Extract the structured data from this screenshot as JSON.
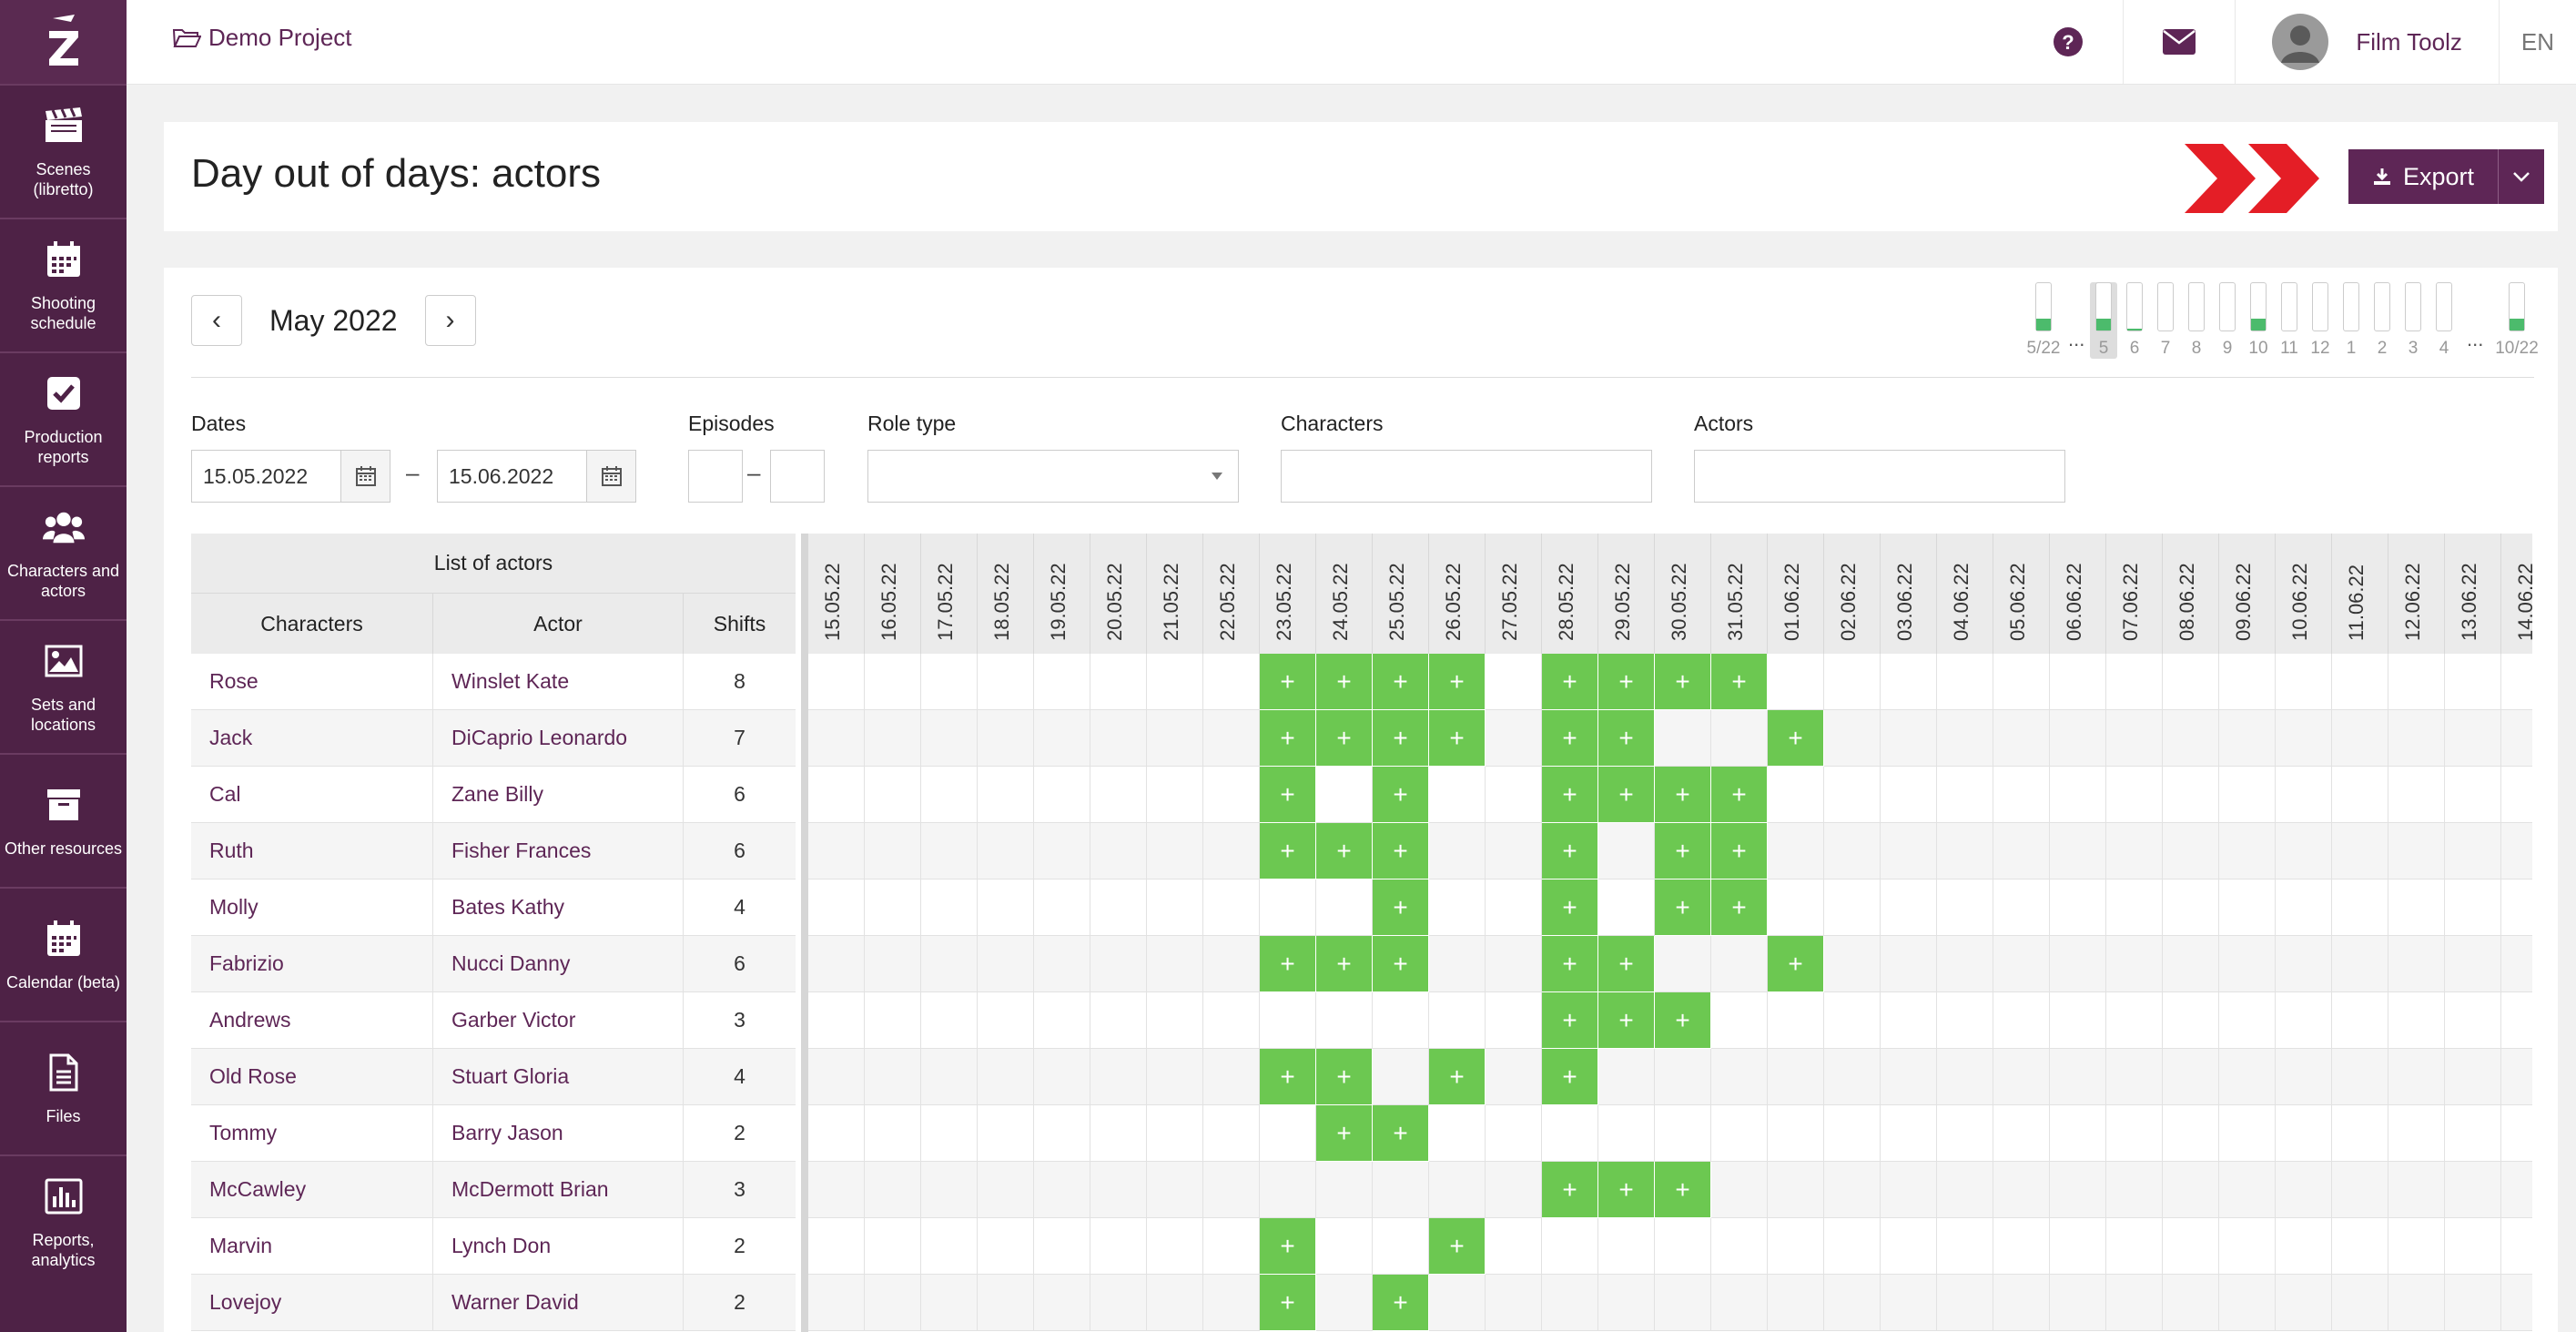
{
  "project": {
    "name": "Demo Project"
  },
  "sidebar": {
    "items": [
      {
        "label": "Scenes (libretto)",
        "icon": "clapperboard-icon"
      },
      {
        "label": "Shooting schedule",
        "icon": "calendar-icon"
      },
      {
        "label": "Production reports",
        "icon": "checkbox-icon"
      },
      {
        "label": "Characters and actors",
        "icon": "users-icon"
      },
      {
        "label": "Sets and locations",
        "icon": "image-icon"
      },
      {
        "label": "Other resources",
        "icon": "archive-icon"
      },
      {
        "label": "Calendar (beta)",
        "icon": "calendar-icon"
      },
      {
        "label": "Files",
        "icon": "file-icon"
      },
      {
        "label": "Reports, analytics",
        "icon": "bar-chart-icon"
      }
    ]
  },
  "header": {
    "user_name": "Film Toolz",
    "language": "EN"
  },
  "page": {
    "title": "Day out of days: actors",
    "export_label": "Export"
  },
  "calendar": {
    "month": "May 2022",
    "prev": "‹",
    "next": "›"
  },
  "mini_bars": {
    "first_label": "5/22",
    "last_label": "10/22",
    "items": [
      {
        "label": "5",
        "fill": 0.25,
        "selected": true
      },
      {
        "label": "6",
        "fill": 0.04
      },
      {
        "label": "7",
        "fill": 0
      },
      {
        "label": "8",
        "fill": 0
      },
      {
        "label": "9",
        "fill": 0
      },
      {
        "label": "10",
        "fill": 0.25
      },
      {
        "label": "11",
        "fill": 0
      },
      {
        "label": "12",
        "fill": 0
      },
      {
        "label": "1",
        "fill": 0
      },
      {
        "label": "2",
        "fill": 0
      },
      {
        "label": "3",
        "fill": 0
      },
      {
        "label": "4",
        "fill": 0
      }
    ],
    "first_fill": 0.25,
    "last_fill": 0.25,
    "dots": "..."
  },
  "filters": {
    "dates_label": "Dates",
    "date_from": "15.05.2022",
    "date_to": "15.06.2022",
    "episodes_label": "Episodes",
    "role_type_label": "Role type",
    "characters_label": "Characters",
    "actors_label": "Actors",
    "dash": "–"
  },
  "table": {
    "list_header": "List of actors",
    "col_characters": "Characters",
    "col_actor": "Actor",
    "col_shifts": "Shifts",
    "dates": [
      "15.05.22",
      "16.05.22",
      "17.05.22",
      "18.05.22",
      "19.05.22",
      "20.05.22",
      "21.05.22",
      "22.05.22",
      "23.05.22",
      "24.05.22",
      "25.05.22",
      "26.05.22",
      "27.05.22",
      "28.05.22",
      "29.05.22",
      "30.05.22",
      "31.05.22",
      "01.06.22",
      "02.06.22",
      "03.06.22",
      "04.06.22",
      "05.06.22",
      "06.06.22",
      "07.06.22",
      "08.06.22",
      "09.06.22",
      "10.06.22",
      "11.06.22",
      "12.06.22",
      "13.06.22",
      "14.06.22"
    ],
    "mark": "+",
    "rows": [
      {
        "character": "Rose",
        "actor": "Winslet Kate",
        "shifts": "8",
        "days": [
          8,
          9,
          10,
          11,
          13,
          14,
          15,
          16
        ]
      },
      {
        "character": "Jaсk",
        "actor": "DiCaprio Leonardo",
        "shifts": "7",
        "days": [
          8,
          9,
          10,
          11,
          13,
          14,
          17
        ]
      },
      {
        "character": "Cal",
        "actor": "Zane Billy",
        "shifts": "6",
        "days": [
          8,
          10,
          13,
          14,
          15,
          16
        ]
      },
      {
        "character": "Ruth",
        "actor": "Fisher Frances",
        "shifts": "6",
        "days": [
          8,
          9,
          10,
          13,
          15,
          16
        ]
      },
      {
        "character": "Molly",
        "actor": "Bates Kathy",
        "shifts": "4",
        "days": [
          10,
          13,
          15,
          16
        ]
      },
      {
        "character": "Fabrizio",
        "actor": "Nucci Danny",
        "shifts": "6",
        "days": [
          8,
          9,
          10,
          13,
          14,
          17
        ]
      },
      {
        "character": "Andrews",
        "actor": "Garber Victor",
        "shifts": "3",
        "days": [
          13,
          14,
          15
        ]
      },
      {
        "character": "Old Rose",
        "actor": "Stuart Gloria",
        "shifts": "4",
        "days": [
          8,
          9,
          11,
          13
        ]
      },
      {
        "character": "Tommy",
        "actor": "Barry Jason",
        "shifts": "2",
        "days": [
          9,
          10
        ]
      },
      {
        "character": "McCawley",
        "actor": "McDermott Brian",
        "shifts": "3",
        "days": [
          13,
          14,
          15
        ]
      },
      {
        "character": "Marvin",
        "actor": "Lynch Don",
        "shifts": "2",
        "days": [
          8,
          11
        ]
      },
      {
        "character": "Lovejoy",
        "actor": "Warner David",
        "shifts": "2",
        "days": [
          8,
          10
        ]
      }
    ]
  },
  "colors": {
    "brand": "#4e2246",
    "accent": "#5e2656",
    "on_cell": "#6cc851",
    "bar_fill": "#4cbb6c",
    "arrow": "#e41e26"
  }
}
